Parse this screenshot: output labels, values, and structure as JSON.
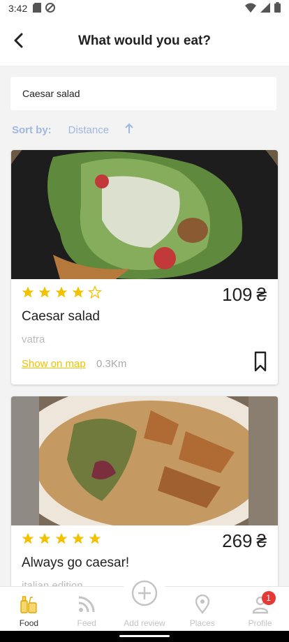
{
  "status_bar": {
    "time": "3:42"
  },
  "header": {
    "title": "What would you eat?"
  },
  "search": {
    "value": "Caesar salad"
  },
  "sort": {
    "label": "Sort by:",
    "value": "Distance"
  },
  "cards": [
    {
      "rating": 4,
      "price": "109",
      "currency": "₴",
      "name": "Caesar salad",
      "place": "vatra",
      "show_on_map": "Show on map",
      "distance": "0.3Km"
    },
    {
      "rating": 5,
      "price": "269",
      "currency": "₴",
      "name": "Always go caesar!",
      "place": "italian edition"
    }
  ],
  "bottom_nav": {
    "food": "Food",
    "feed": "Feed",
    "add_review": "Add review",
    "places": "Places",
    "profile": "Profile",
    "profile_badge": "1"
  },
  "colors": {
    "accent": "#f2c200",
    "sort_text": "#9fb6e6",
    "badge": "#e53935"
  }
}
